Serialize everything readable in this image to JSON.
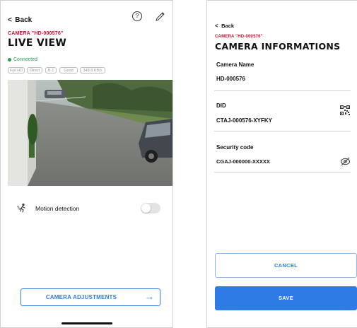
{
  "live_view": {
    "back_label": "Back",
    "camera_name": "CAMERA \"HD-000576\"",
    "title": "LIVE VIEW",
    "status": "Connected",
    "chips": [
      "Full HD",
      "Direct",
      "B-1",
      "Good",
      "348.8 KB/s"
    ],
    "motion_label": "Motion detection",
    "motion_enabled": false,
    "adjustments_label": "CAMERA ADJUSTMENTS",
    "adjustments_arrow": "→"
  },
  "camera_info": {
    "back_label": "Back",
    "camera_name": "CAMERA \"HD-000576\"",
    "title": "CAMERA INFORMATIONS",
    "fields": [
      {
        "label": "Camera Name",
        "value": "HD-000576"
      },
      {
        "label": "DID",
        "value": "CTAJ-000576-XYFKY"
      },
      {
        "label": "Security code",
        "value": "CGAJ-000000-XXXXX"
      }
    ],
    "cancel_label": "CANCEL",
    "save_label": "SAVE"
  },
  "colors": {
    "accent": "#2f7be6",
    "brand_red": "#c8102e",
    "connected": "#2a9d4a"
  },
  "icons": [
    "chevron-left-icon",
    "help-icon",
    "pencil-icon",
    "motion-icon",
    "arrow-right-icon",
    "qr-code-icon",
    "eye-slash-icon"
  ]
}
